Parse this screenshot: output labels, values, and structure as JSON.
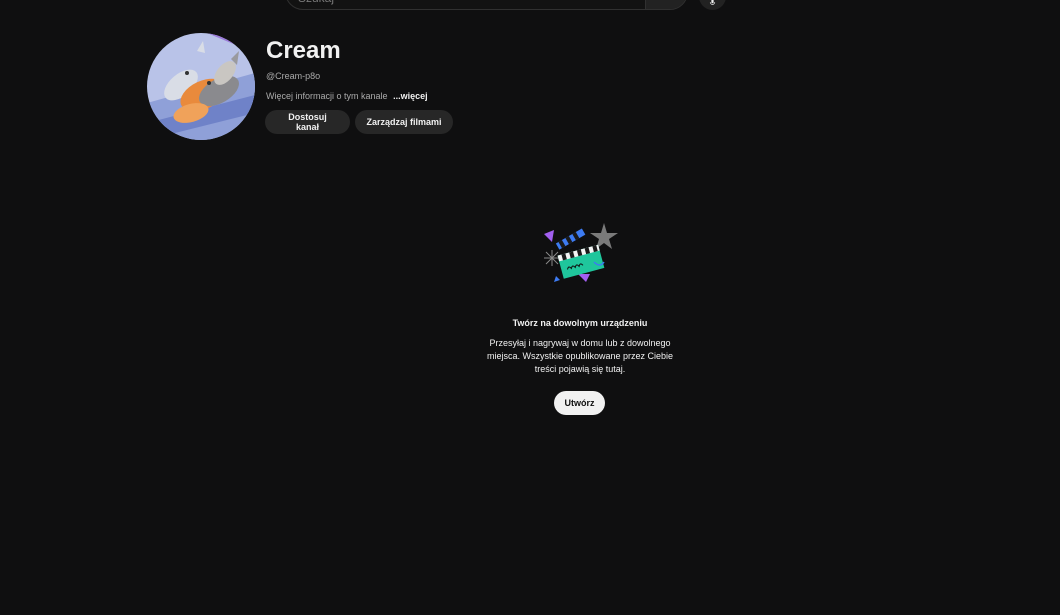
{
  "search": {
    "placeholder": "Szukaj"
  },
  "channel": {
    "name": "Cream",
    "handle": "@Cream-p8o",
    "description": "Więcej informacji o tym kanale",
    "more_link": "...więcej",
    "customize_button": "Dostosuj kanał",
    "manage_videos_button": "Zarządzaj filmami"
  },
  "empty_state": {
    "title": "Twórz na dowolnym urządzeniu",
    "description": "Przesyłaj i nagrywaj w domu lub z dowolnego miejsca. Wszystkie opublikowane przez Ciebie treści pojawią się tutaj.",
    "create_button": "Utwórz"
  },
  "icons": [
    "search-icon",
    "microphone-icon",
    "clapperboard-icon",
    "star-icon",
    "avatar-cats-image"
  ],
  "colors": {
    "background": "#0f0f10",
    "pill_bg": "#272727",
    "text_primary": "#f1f1f1",
    "text_secondary": "#aaaaaa",
    "illustration_green": "#1fc69c",
    "illustration_purple": "#a25ff0"
  }
}
